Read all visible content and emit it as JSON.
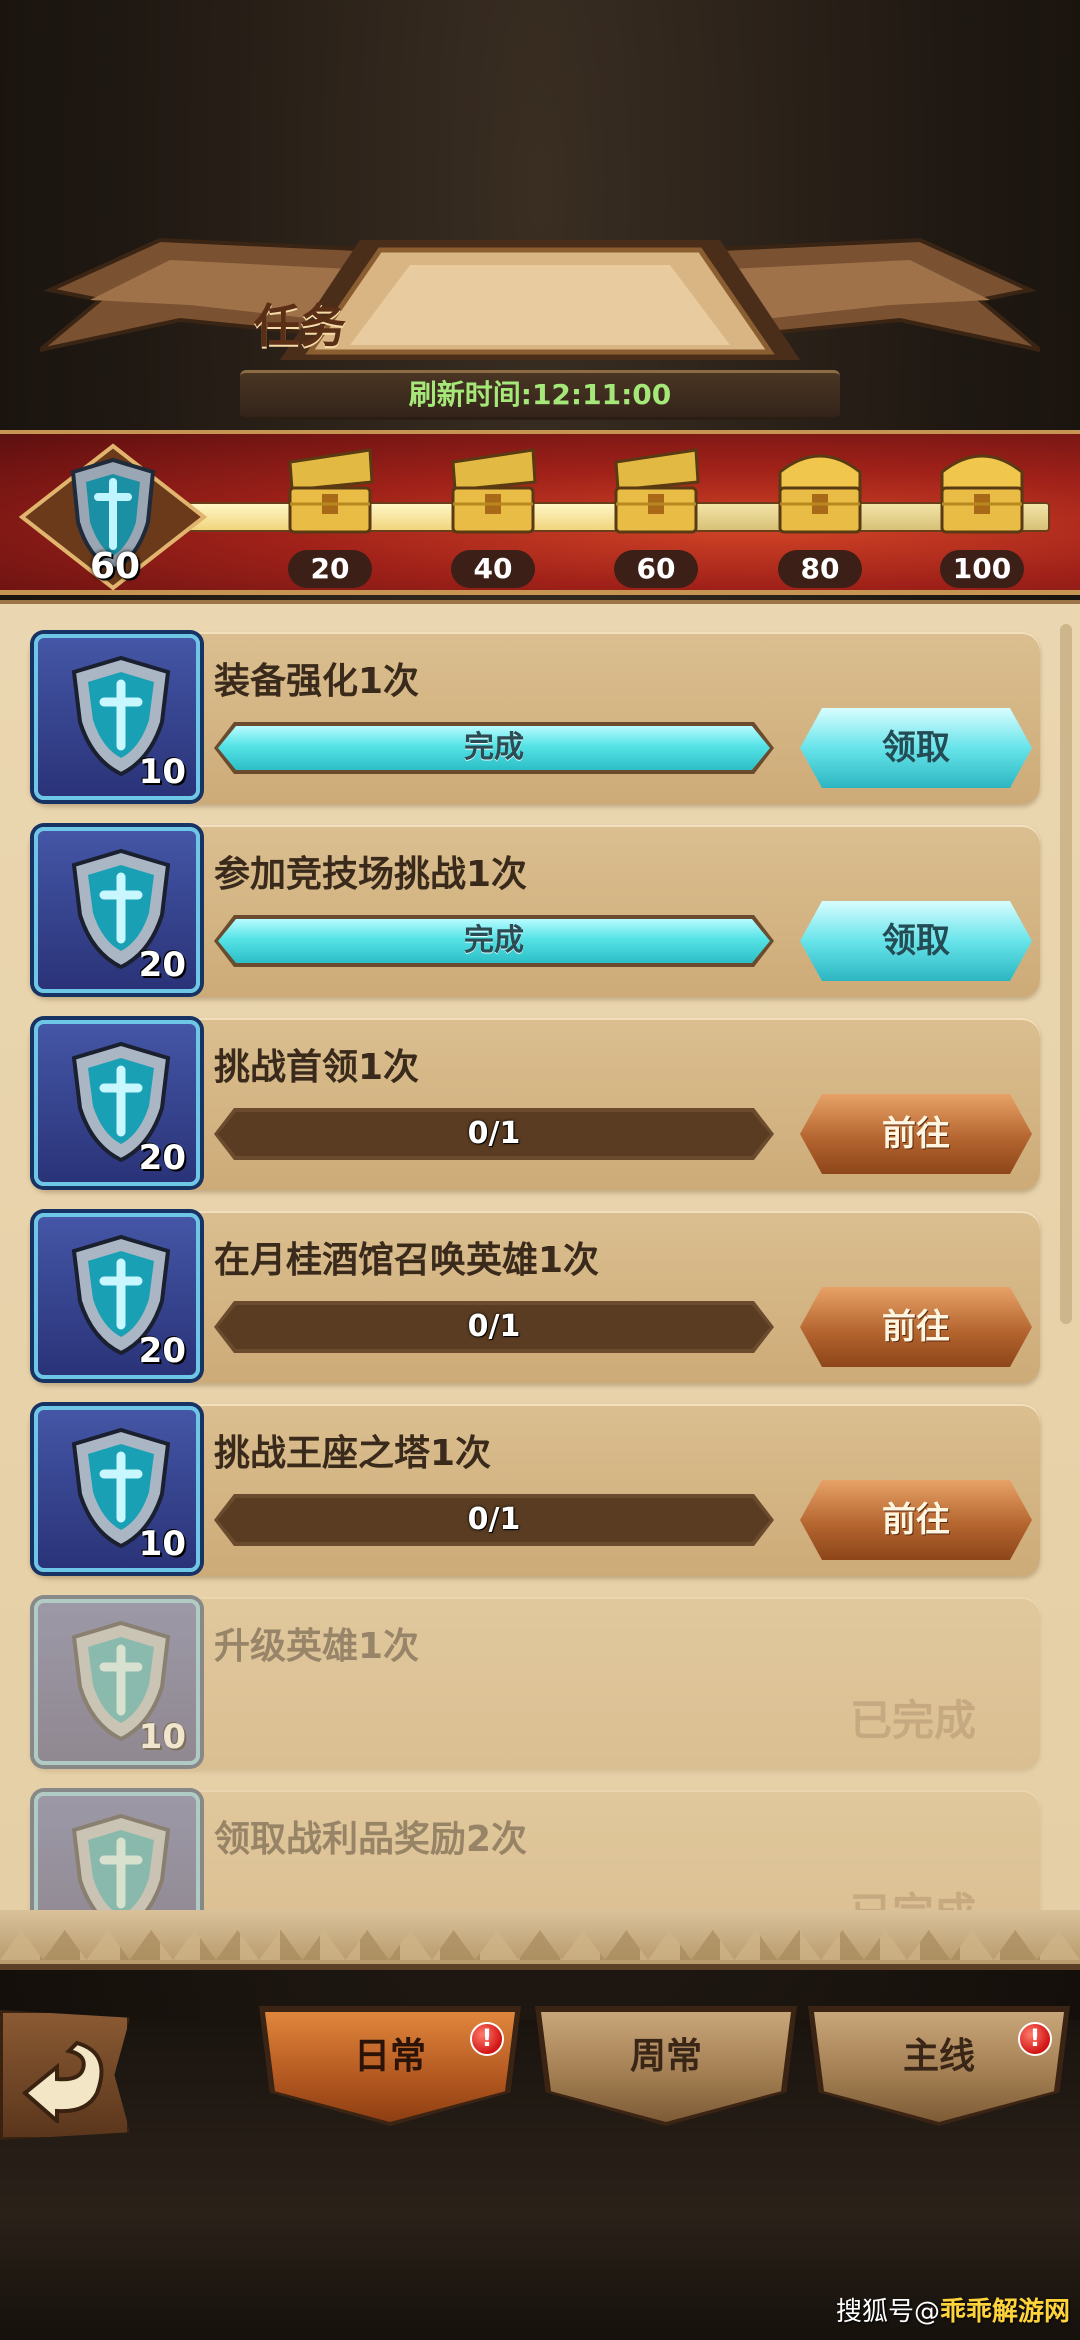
{
  "header": {
    "title": "任务",
    "refresh_label": "刷新时间:12:11:00"
  },
  "progress": {
    "current_points": "60",
    "max_points": 100,
    "milestones": [
      {
        "threshold": "20",
        "state": "opened"
      },
      {
        "threshold": "40",
        "state": "opened"
      },
      {
        "threshold": "60",
        "state": "opened"
      },
      {
        "threshold": "80",
        "state": "closed"
      },
      {
        "threshold": "100",
        "state": "closed"
      }
    ]
  },
  "tasks": [
    {
      "name": "装备强化1次",
      "points": "10",
      "status_text": "完成",
      "progress": 1.0,
      "button": "领取",
      "state": "claimable"
    },
    {
      "name": "参加竞技场挑战1次",
      "points": "20",
      "status_text": "完成",
      "progress": 1.0,
      "button": "领取",
      "state": "claimable"
    },
    {
      "name": "挑战首领1次",
      "points": "20",
      "status_text": "0/1",
      "progress": 0.0,
      "button": "前往",
      "state": "go"
    },
    {
      "name": "在月桂酒馆召唤英雄1次",
      "points": "20",
      "status_text": "0/1",
      "progress": 0.0,
      "button": "前往",
      "state": "go"
    },
    {
      "name": "挑战王座之塔1次",
      "points": "10",
      "status_text": "0/1",
      "progress": 0.0,
      "button": "前往",
      "state": "go"
    },
    {
      "name": "升级英雄1次",
      "points": "10",
      "completed_label": "已完成",
      "state": "completed"
    },
    {
      "name": "领取战利品奖励2次",
      "completed_label": "已完成",
      "state": "completed"
    }
  ],
  "tabs": [
    {
      "label": "日常",
      "active": true,
      "badge": "!"
    },
    {
      "label": "周常",
      "active": false
    },
    {
      "label": "主线",
      "active": false,
      "badge": "!"
    }
  ],
  "watermark": {
    "prefix": "搜狐号@",
    "brand": "乖乖解游网"
  },
  "colors": {
    "panel_bg": "#ead6b0",
    "task_card": "#cdab78",
    "claim_button": "#67e4ea",
    "go_button": "#b56630",
    "progress_strip": "#a02119",
    "refresh_text": "#a5e879",
    "badge": "#d11414"
  }
}
